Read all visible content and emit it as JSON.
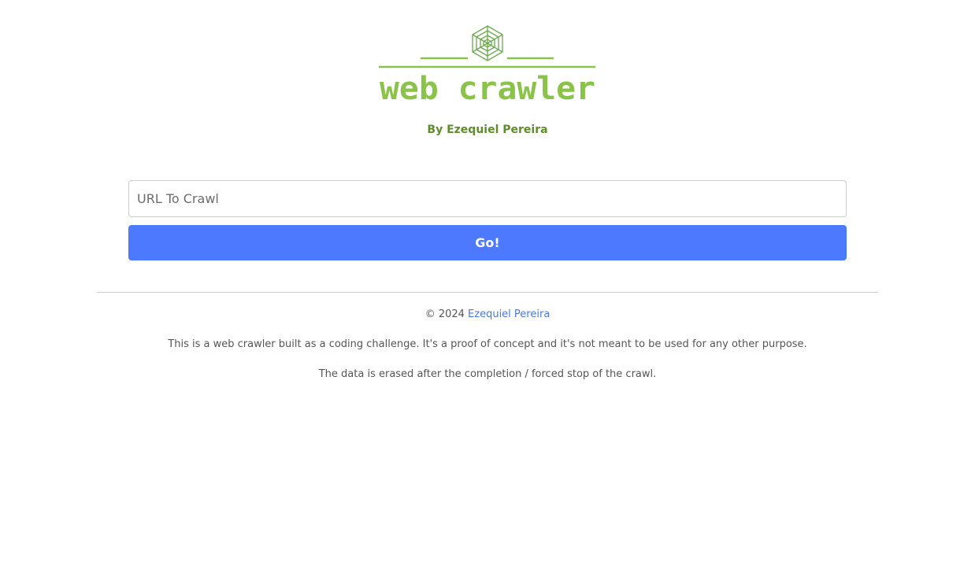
{
  "header": {
    "logo_text": "web crawler",
    "byline": "By Ezequiel Pereira"
  },
  "form": {
    "url_placeholder": "URL To Crawl",
    "url_value": "",
    "go_label": "Go!"
  },
  "footer": {
    "copyright_prefix": "© 2024",
    "author_link": "Ezequiel Pereira",
    "disclaimer": "This is a web crawler built as a coding challenge. It's a proof of concept and it's not meant to be used for any other purpose.",
    "data_note": "The data is erased after the completion / forced stop of the crawl."
  },
  "colors": {
    "logo_green": "#8bc34a",
    "byline_green": "#5f8c2d",
    "button_blue": "#4d79ff",
    "link_blue": "#4a7ad8"
  },
  "icons": {
    "logo_emblem": "spider-web-icon"
  }
}
